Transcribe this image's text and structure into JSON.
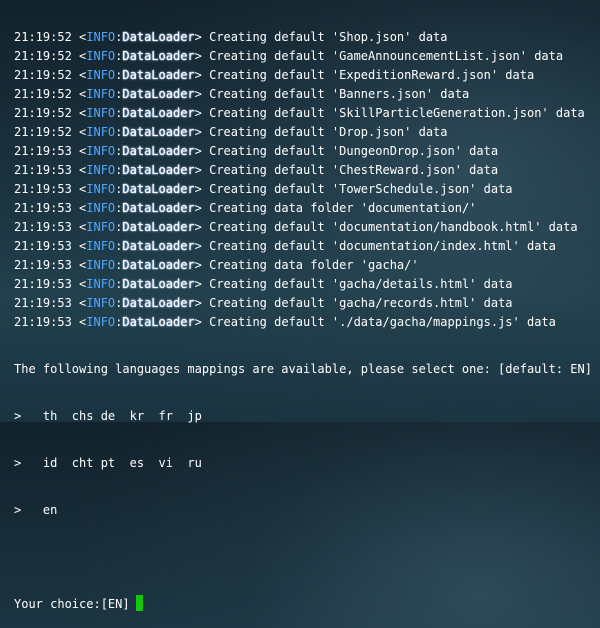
{
  "log_lines": [
    {
      "time": "21:19:52",
      "level": "INFO",
      "logger": "DataLoader",
      "message": "Creating default 'Shop.json' data"
    },
    {
      "time": "21:19:52",
      "level": "INFO",
      "logger": "DataLoader",
      "message": "Creating default 'GameAnnouncementList.json' data"
    },
    {
      "time": "21:19:52",
      "level": "INFO",
      "logger": "DataLoader",
      "message": "Creating default 'ExpeditionReward.json' data"
    },
    {
      "time": "21:19:52",
      "level": "INFO",
      "logger": "DataLoader",
      "message": "Creating default 'Banners.json' data"
    },
    {
      "time": "21:19:52",
      "level": "INFO",
      "logger": "DataLoader",
      "message": "Creating default 'SkillParticleGeneration.json' data"
    },
    {
      "time": "21:19:52",
      "level": "INFO",
      "logger": "DataLoader",
      "message": "Creating default 'Drop.json' data"
    },
    {
      "time": "21:19:53",
      "level": "INFO",
      "logger": "DataLoader",
      "message": "Creating default 'DungeonDrop.json' data"
    },
    {
      "time": "21:19:53",
      "level": "INFO",
      "logger": "DataLoader",
      "message": "Creating default 'ChestReward.json' data"
    },
    {
      "time": "21:19:53",
      "level": "INFO",
      "logger": "DataLoader",
      "message": "Creating default 'TowerSchedule.json' data"
    },
    {
      "time": "21:19:53",
      "level": "INFO",
      "logger": "DataLoader",
      "message": "Creating data folder 'documentation/'"
    },
    {
      "time": "21:19:53",
      "level": "INFO",
      "logger": "DataLoader",
      "message": "Creating default 'documentation/handbook.html' data"
    },
    {
      "time": "21:19:53",
      "level": "INFO",
      "logger": "DataLoader",
      "message": "Creating default 'documentation/index.html' data"
    },
    {
      "time": "21:19:53",
      "level": "INFO",
      "logger": "DataLoader",
      "message": "Creating data folder 'gacha/'"
    },
    {
      "time": "21:19:53",
      "level": "INFO",
      "logger": "DataLoader",
      "message": "Creating default 'gacha/details.html' data"
    },
    {
      "time": "21:19:53",
      "level": "INFO",
      "logger": "DataLoader",
      "message": "Creating default 'gacha/records.html' data"
    },
    {
      "time": "21:19:53",
      "level": "INFO",
      "logger": "DataLoader",
      "message": "Creating default './data/gacha/mappings.js' data"
    }
  ],
  "prompt": {
    "question": "The following languages mappings are available, please select one: [default: EN]",
    "options": [
      ">   th  chs de  kr  fr  jp",
      ">   id  cht pt  es  vi  ru",
      ">   en"
    ],
    "input_label": "Your choice:[EN]"
  },
  "colors": {
    "level": "#4ea8ff",
    "cursor": "#16c60c",
    "text": "#ffffff"
  }
}
